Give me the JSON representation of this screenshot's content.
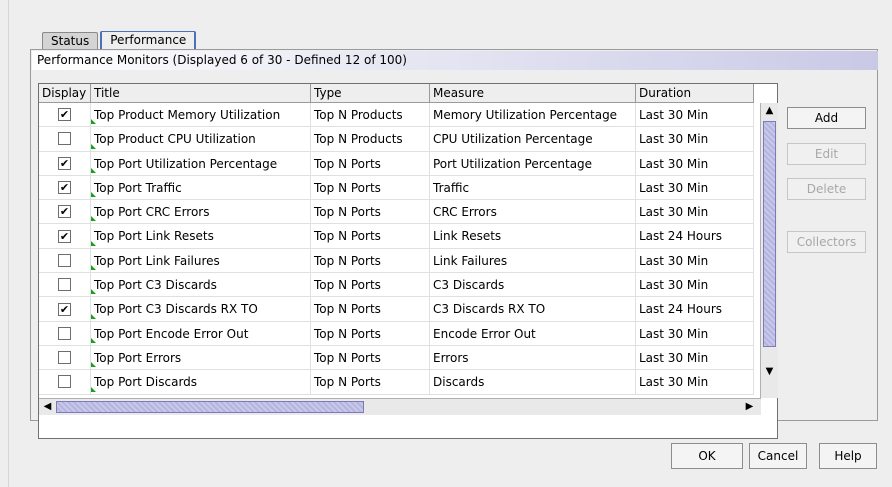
{
  "tabs": [
    {
      "label": "Status",
      "active": false
    },
    {
      "label": "Performance",
      "active": true
    }
  ],
  "panel": {
    "title": "Performance Monitors (Displayed 6 of 30 - Defined 12 of 100)"
  },
  "table": {
    "columns": [
      "Display",
      "Title",
      "Type",
      "Measure",
      "Duration"
    ],
    "rows": [
      {
        "display": "✔",
        "title": "Top Product Memory Utilization",
        "type": "Top N Products",
        "measure": "Memory Utilization Percentage",
        "duration": "Last 30 Min"
      },
      {
        "display": "",
        "title": "Top Product CPU Utilization",
        "type": "Top N Products",
        "measure": "CPU Utilization Percentage",
        "duration": "Last 30 Min"
      },
      {
        "display": "✔",
        "title": "Top Port Utilization Percentage",
        "type": "Top N Ports",
        "measure": "Port Utilization Percentage",
        "duration": "Last 30 Min"
      },
      {
        "display": "✔",
        "title": "Top Port Traffic",
        "type": "Top N Ports",
        "measure": "Traffic",
        "duration": "Last 30 Min"
      },
      {
        "display": "✔",
        "title": "Top Port CRC Errors",
        "type": "Top N Ports",
        "measure": "CRC Errors",
        "duration": "Last 30 Min"
      },
      {
        "display": "✔",
        "title": "Top Port Link Resets",
        "type": "Top N Ports",
        "measure": "Link Resets",
        "duration": "Last 24 Hours"
      },
      {
        "display": "",
        "title": "Top Port Link Failures",
        "type": "Top N Ports",
        "measure": "Link Failures",
        "duration": "Last 30 Min"
      },
      {
        "display": "",
        "title": "Top Port C3 Discards",
        "type": "Top N Ports",
        "measure": "C3 Discards",
        "duration": "Last 30 Min"
      },
      {
        "display": "✔",
        "title": "Top Port C3 Discards RX TO",
        "type": "Top N Ports",
        "measure": "C3 Discards RX TO",
        "duration": "Last 24 Hours"
      },
      {
        "display": "",
        "title": "Top Port Encode Error Out",
        "type": "Top N Ports",
        "measure": "Encode Error Out",
        "duration": "Last 30 Min"
      },
      {
        "display": "",
        "title": "Top Port Errors",
        "type": "Top N Ports",
        "measure": "Errors",
        "duration": "Last 30 Min"
      },
      {
        "display": "",
        "title": "Top Port Discards",
        "type": "Top N Ports",
        "measure": "Discards",
        "duration": "Last 30 Min"
      }
    ]
  },
  "side_buttons": {
    "add": "Add",
    "edit": "Edit",
    "delete": "Delete",
    "collectors": "Collectors"
  },
  "footer": {
    "ok": "OK",
    "cancel": "Cancel",
    "help": "Help"
  },
  "icons": {
    "scroll_up": "▲",
    "scroll_down": "▼",
    "scroll_left": "◀",
    "scroll_right": "▶"
  },
  "colors": {
    "accent": "#4f6fb8",
    "thumb": "#b4b4de",
    "marker": "#1aa11a",
    "disabled_text": "#a8a8a8"
  }
}
